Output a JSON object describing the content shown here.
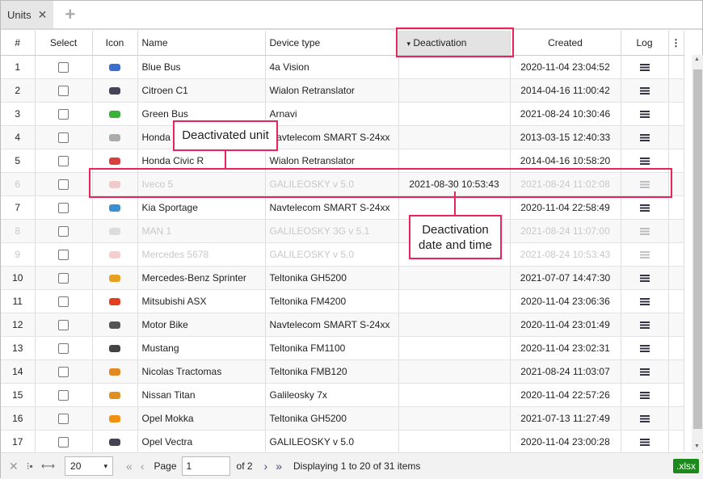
{
  "tabs": [
    {
      "label": "Units"
    }
  ],
  "columns": [
    "#",
    "Select",
    "Icon",
    "Name",
    "Device type",
    "Deactivation",
    "Created",
    "Log"
  ],
  "sort_indicator": "▾",
  "rows": [
    {
      "n": "1",
      "name": "Blue Bus",
      "device": "4a Vision",
      "deact": "",
      "created": "2020-11-04 23:04:52",
      "color": "#3a6fd0",
      "active": true
    },
    {
      "n": "2",
      "name": "Citroen C1",
      "device": "Wialon Retranslator",
      "deact": "",
      "created": "2014-04-16 11:00:42",
      "color": "#445",
      "active": true
    },
    {
      "n": "3",
      "name": "Green Bus",
      "device": "Arnavi",
      "deact": "",
      "created": "2021-08-24 10:30:46",
      "color": "#3bb33b",
      "active": true
    },
    {
      "n": "4",
      "name": "Honda",
      "device": "Navtelecom SMART S-24xx",
      "deact": "",
      "created": "2013-03-15 12:40:33",
      "color": "#aaa",
      "active": true
    },
    {
      "n": "5",
      "name": "Honda Civic R",
      "device": "Wialon Retranslator",
      "deact": "",
      "created": "2014-04-16 10:58:20",
      "color": "#d84040",
      "active": true
    },
    {
      "n": "6",
      "name": "Iveco 5",
      "device": "GALILEOSKY v 5.0",
      "deact": "2021-08-30 10:53:43",
      "created": "2021-08-24 11:02:08",
      "color": "#d84040",
      "active": false
    },
    {
      "n": "7",
      "name": "Kia Sportage",
      "device": "Navtelecom SMART S-24xx",
      "deact": "",
      "created": "2020-11-04 22:58:49",
      "color": "#3a8fd0",
      "active": true
    },
    {
      "n": "8",
      "name": "MAN 1",
      "device": "GALILEOSKY 3G v 5.1",
      "deact": "",
      "created": "2021-08-24 11:07:00",
      "color": "#888",
      "active": false
    },
    {
      "n": "9",
      "name": "Mercedes 5678",
      "device": "GALILEOSKY v 5.0",
      "deact": "",
      "created": "2021-08-24 10:53:43",
      "color": "#d84040",
      "active": false
    },
    {
      "n": "10",
      "name": "Mercedes-Benz Sprinter",
      "device": "Teltonika GH5200",
      "deact": "",
      "created": "2021-07-07 14:47:30",
      "color": "#e8a020",
      "active": true
    },
    {
      "n": "11",
      "name": "Mitsubishi ASX",
      "device": "Teltonika FM4200",
      "deact": "",
      "created": "2020-11-04 23:06:36",
      "color": "#e04020",
      "active": true
    },
    {
      "n": "12",
      "name": "Motor Bike",
      "device": "Navtelecom SMART S-24xx",
      "deact": "",
      "created": "2020-11-04 23:01:49",
      "color": "#555",
      "active": true
    },
    {
      "n": "13",
      "name": "Mustang",
      "device": "Teltonika FM1100",
      "deact": "",
      "created": "2020-11-04 23:02:31",
      "color": "#444",
      "active": true
    },
    {
      "n": "14",
      "name": "Nicolas Tractomas",
      "device": "Teltonika FMB120",
      "deact": "",
      "created": "2021-08-24 11:03:07",
      "color": "#e08a20",
      "active": true
    },
    {
      "n": "15",
      "name": "Nissan Titan",
      "device": "Galileosky 7x",
      "deact": "",
      "created": "2020-11-04 22:57:26",
      "color": "#e09020",
      "active": true
    },
    {
      "n": "16",
      "name": "Opel Mokka",
      "device": "Teltonika GH5200",
      "deact": "",
      "created": "2021-07-13 11:27:49",
      "color": "#f09010",
      "active": true
    },
    {
      "n": "17",
      "name": "Opel Vectra",
      "device": "GALILEOSKY v 5.0",
      "deact": "",
      "created": "2020-11-04 23:00:28",
      "color": "#445",
      "active": true
    }
  ],
  "footer": {
    "per_page": "20",
    "page_label": "Page",
    "page": "1",
    "of": "of 2",
    "displaying": "Displaying 1 to 20 of 31 items",
    "export": ".xlsx"
  },
  "callouts": {
    "unit": "Deactivated unit",
    "date": "Deactivation date and time"
  }
}
